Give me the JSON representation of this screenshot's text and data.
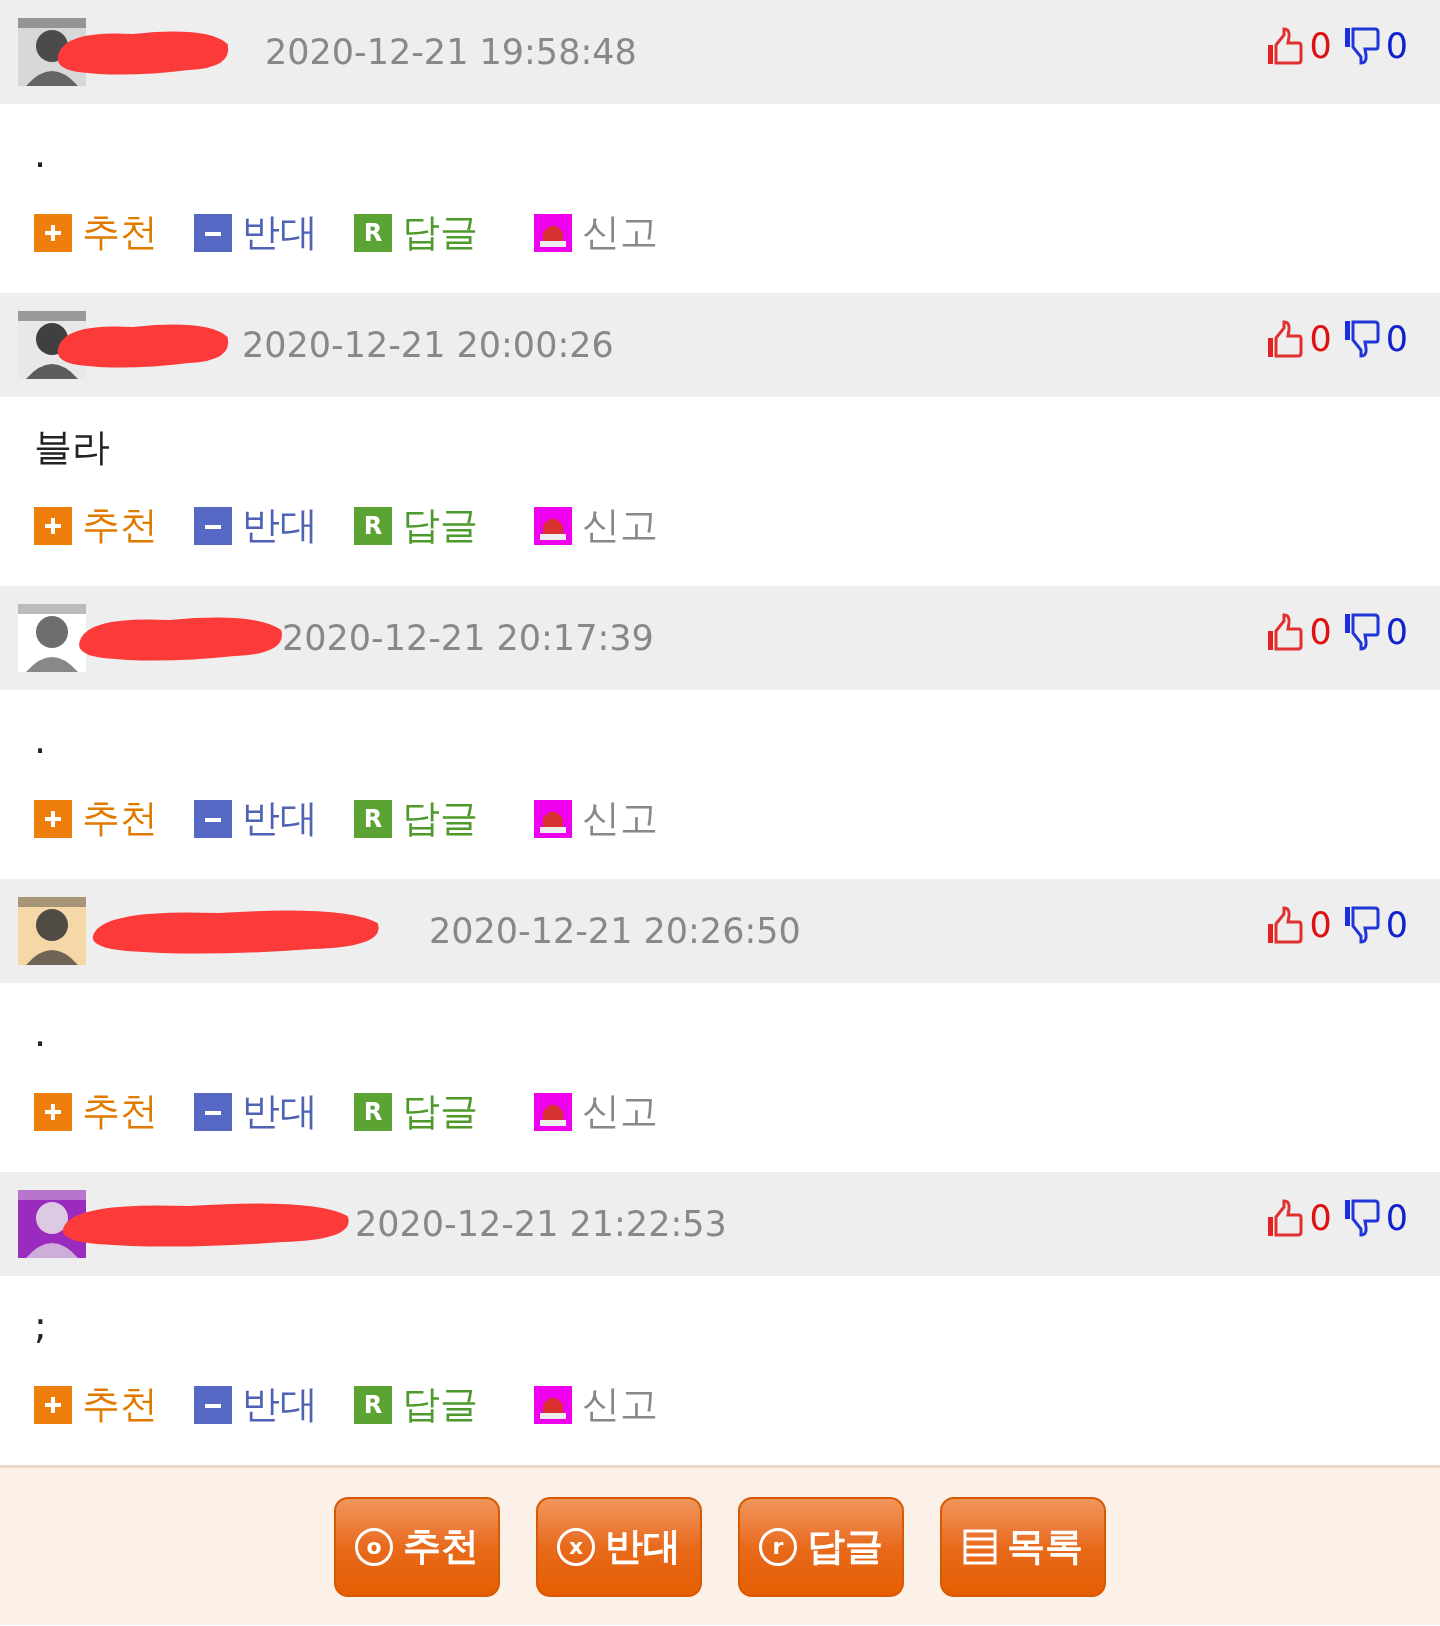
{
  "comments": [
    {
      "name_redacted": true,
      "time": "2020-12-21 19:58:48",
      "likes": "0",
      "dislikes": "0",
      "text": ".",
      "actions": [
        {
          "kind": "recommend",
          "label": "추천"
        },
        {
          "kind": "oppose",
          "label": "반대"
        },
        {
          "kind": "reply",
          "label": "답글",
          "badge": "R"
        },
        {
          "kind": "report",
          "label": "신고"
        }
      ]
    },
    {
      "name_redacted": true,
      "time": "2020-12-21 20:00:26",
      "likes": "0",
      "dislikes": "0",
      "text": "블라",
      "actions": [
        {
          "kind": "recommend",
          "label": "추천"
        },
        {
          "kind": "oppose",
          "label": "반대"
        },
        {
          "kind": "reply",
          "label": "답글",
          "badge": "R"
        },
        {
          "kind": "report",
          "label": "신고"
        }
      ]
    },
    {
      "name_redacted": true,
      "time": "2020-12-21 20:17:39",
      "likes": "0",
      "dislikes": "0",
      "text": ".",
      "actions": [
        {
          "kind": "recommend",
          "label": "추천"
        },
        {
          "kind": "oppose",
          "label": "반대"
        },
        {
          "kind": "reply",
          "label": "답글",
          "badge": "R"
        },
        {
          "kind": "report",
          "label": "신고"
        }
      ]
    },
    {
      "name_redacted": true,
      "time": "2020-12-21 20:26:50",
      "likes": "0",
      "dislikes": "0",
      "text": ".",
      "actions": [
        {
          "kind": "recommend",
          "label": "추천"
        },
        {
          "kind": "oppose",
          "label": "반대"
        },
        {
          "kind": "reply",
          "label": "답글",
          "badge": "R"
        },
        {
          "kind": "report",
          "label": "신고"
        }
      ]
    },
    {
      "name_redacted": true,
      "time": "2020-12-21 21:22:53",
      "likes": "0",
      "dislikes": "0",
      "text": ";",
      "actions": [
        {
          "kind": "recommend",
          "label": "추천"
        },
        {
          "kind": "oppose",
          "label": "반대"
        },
        {
          "kind": "reply",
          "label": "답글",
          "badge": "R"
        },
        {
          "kind": "report",
          "label": "신고"
        }
      ]
    }
  ],
  "footer_buttons": [
    {
      "kind": "circle",
      "glyph": "o",
      "label": "추천"
    },
    {
      "kind": "circle",
      "glyph": "x",
      "label": "반대"
    },
    {
      "kind": "circle",
      "glyph": "r",
      "label": "답글"
    },
    {
      "kind": "list",
      "label": "목록"
    }
  ]
}
